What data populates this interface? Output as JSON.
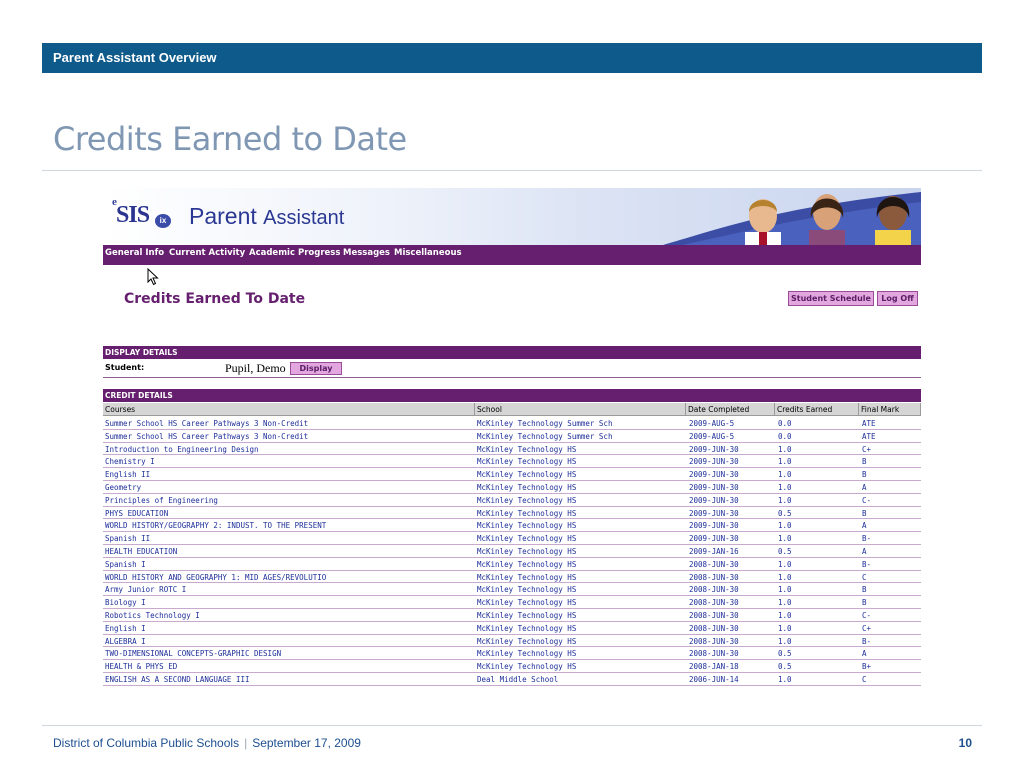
{
  "slide": {
    "header": "Parent Assistant Overview",
    "title": "Credits Earned to Date",
    "footer_org": "District of Columbia Public Schools",
    "footer_sep": "|",
    "footer_date": "September 17, 2009",
    "page_number": "10"
  },
  "app": {
    "logo_e": "e",
    "logo_sis": "SIS",
    "logo_ix": "ix",
    "brand_main": "Parent",
    "brand_sub": "Assistant",
    "nav": [
      "General Info",
      "Current Activity",
      "Academic Progress",
      "Messages",
      "Miscellaneous"
    ],
    "page_heading": "Credits Earned To Date",
    "buttons": {
      "student_schedule": "Student Schedule",
      "log_off": "Log Off",
      "display": "Display"
    },
    "display_details": {
      "title": "DISPLAY DETAILS",
      "student_label": "Student:",
      "student_value": "Pupil, Demo"
    },
    "credit_details": {
      "title": "CREDIT DETAILS",
      "columns": [
        "Courses",
        "School",
        "Date Completed",
        "Credits Earned",
        "Final Mark"
      ],
      "rows": [
        [
          "Summer School HS Career Pathways 3 Non-Credit",
          "McKinley Technology Summer Sch",
          "2009-AUG-5",
          "0.0",
          "ATE"
        ],
        [
          "Summer School HS Career Pathways 3 Non-Credit",
          "McKinley Technology Summer Sch",
          "2009-AUG-5",
          "0.0",
          "ATE"
        ],
        [
          "Introduction to Engineering Design",
          "McKinley Technology HS",
          "2009-JUN-30",
          "1.0",
          "C+"
        ],
        [
          "Chemistry I",
          "McKinley Technology HS",
          "2009-JUN-30",
          "1.0",
          "B"
        ],
        [
          "English II",
          "McKinley Technology HS",
          "2009-JUN-30",
          "1.0",
          "B"
        ],
        [
          "Geometry",
          "McKinley Technology HS",
          "2009-JUN-30",
          "1.0",
          "A"
        ],
        [
          "Principles of Engineering",
          "McKinley Technology HS",
          "2009-JUN-30",
          "1.0",
          "C-"
        ],
        [
          "PHYS EDUCATION",
          "McKinley Technology HS",
          "2009-JUN-30",
          "0.5",
          "B"
        ],
        [
          "WORLD HISTORY/GEOGRAPHY 2: INDUST. TO THE PRESENT",
          "McKinley Technology HS",
          "2009-JUN-30",
          "1.0",
          "A"
        ],
        [
          "Spanish II",
          "McKinley Technology HS",
          "2009-JUN-30",
          "1.0",
          "B-"
        ],
        [
          "HEALTH EDUCATION",
          "McKinley Technology HS",
          "2009-JAN-16",
          "0.5",
          "A"
        ],
        [
          "Spanish I",
          "McKinley Technology HS",
          "2008-JUN-30",
          "1.0",
          "B-"
        ],
        [
          "WORLD HISTORY AND GEOGRAPHY 1: MID AGES/REVOLUTIO",
          "McKinley Technology HS",
          "2008-JUN-30",
          "1.0",
          "C"
        ],
        [
          "Army Junior ROTC I",
          "McKinley Technology HS",
          "2008-JUN-30",
          "1.0",
          "B"
        ],
        [
          "Biology I",
          "McKinley Technology HS",
          "2008-JUN-30",
          "1.0",
          "B"
        ],
        [
          "Robotics Technology I",
          "McKinley Technology HS",
          "2008-JUN-30",
          "1.0",
          "C-"
        ],
        [
          "English I",
          "McKinley Technology HS",
          "2008-JUN-30",
          "1.0",
          "C+"
        ],
        [
          "ALGEBRA I",
          "McKinley Technology HS",
          "2008-JUN-30",
          "1.0",
          "B-"
        ],
        [
          "TWO-DIMENSIONAL CONCEPTS-GRAPHIC DESIGN",
          "McKinley Technology HS",
          "2008-JUN-30",
          "0.5",
          "A"
        ],
        [
          "HEALTH & PHYS ED",
          "McKinley Technology HS",
          "2008-JAN-18",
          "0.5",
          "B+"
        ],
        [
          "ENGLISH AS A SECOND LANGUAGE III",
          "Deal Middle School",
          "2006-JUN-14",
          "1.0",
          "C"
        ]
      ]
    }
  }
}
